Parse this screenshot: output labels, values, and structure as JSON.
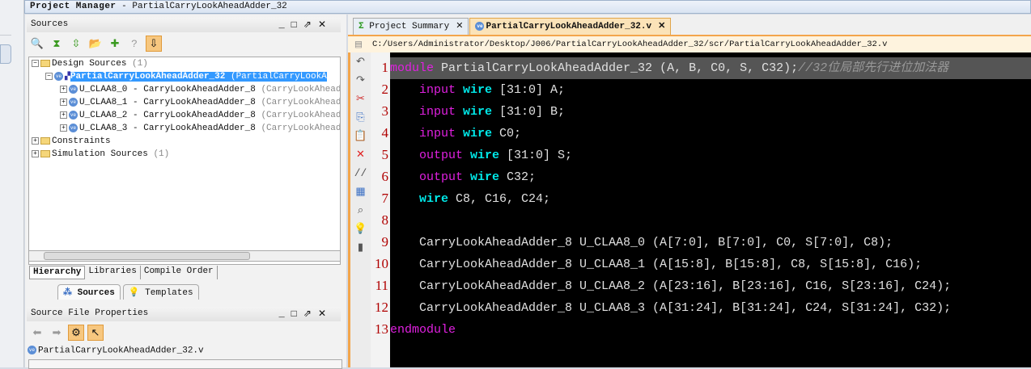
{
  "title_bar": {
    "title": "Project Manager",
    "subtitle": "PartialCarryLookAheadAdder_32"
  },
  "sources_panel": {
    "title": "Sources",
    "tree": {
      "design_sources": "Design Sources",
      "design_count": "(1)",
      "top": {
        "name": "PartialCarryLookAheadAdder_32",
        "detail": "(PartialCarryLookA"
      },
      "children": [
        {
          "name": "U_CLAA8_0 - CarryLookAheadAdder_8",
          "detail": "(CarryLookAheadAdd"
        },
        {
          "name": "U_CLAA8_1 - CarryLookAheadAdder_8",
          "detail": "(CarryLookAheadAdd"
        },
        {
          "name": "U_CLAA8_2 - CarryLookAheadAdder_8",
          "detail": "(CarryLookAheadAdd"
        },
        {
          "name": "U_CLAA8_3 - CarryLookAheadAdder_8",
          "detail": "(CarryLookAheadAdd"
        }
      ],
      "constraints": "Constraints",
      "simulation_sources": "Simulation Sources",
      "simulation_count": "(1)"
    },
    "view_tabs": [
      "Hierarchy",
      "Libraries",
      "Compile Order"
    ],
    "bottom_tabs": [
      "Sources",
      "Templates"
    ]
  },
  "properties_panel": {
    "title": "Source File Properties",
    "file": "PartialCarryLookAheadAdder_32.v"
  },
  "editor": {
    "tabs": [
      "Project Summary",
      "PartialCarryLookAheadAdder_32.v"
    ],
    "path": "C:/Users/Administrator/Desktop/J006/PartialCarryLookAheadAdder_32/scr/PartialCarryLookAheadAdder_32.v",
    "lines": [
      {
        "n": "1",
        "kw": "module",
        "rest": " PartialCarryLookAheadAdder_32 (A, B, C0, S, C32);",
        "cm": "//32位局部先行进位加法器"
      },
      {
        "n": "2",
        "kw": "    input",
        "wr": " wire",
        "rest": " [31:0] A;"
      },
      {
        "n": "3",
        "kw": "    input",
        "wr": " wire",
        "rest": " [31:0] B;"
      },
      {
        "n": "4",
        "kw": "    input",
        "wr": " wire",
        "rest": " C0;"
      },
      {
        "n": "5",
        "kw": "    output",
        "wr": " wire",
        "rest": " [31:0] S;"
      },
      {
        "n": "6",
        "kw": "    output",
        "wr": " wire",
        "rest": " C32;"
      },
      {
        "n": "7",
        "wr": "    wire",
        "rest": " C8, C16, C24;"
      },
      {
        "n": "8",
        "rest": ""
      },
      {
        "n": "9",
        "rest": "    CarryLookAheadAdder_8 U_CLAA8_0 (A[7:0], B[7:0], C0, S[7:0], C8);"
      },
      {
        "n": "10",
        "rest": "    CarryLookAheadAdder_8 U_CLAA8_1 (A[15:8], B[15:8], C8, S[15:8], C16);"
      },
      {
        "n": "11",
        "rest": "    CarryLookAheadAdder_8 U_CLAA8_2 (A[23:16], B[23:16], C16, S[23:16], C24);"
      },
      {
        "n": "12",
        "rest": "    CarryLookAheadAdder_8 U_CLAA8_3 (A[31:24], B[31:24], C24, S[31:24], C32);"
      },
      {
        "n": "13",
        "kw": "endmodule",
        "rest": ""
      }
    ]
  }
}
